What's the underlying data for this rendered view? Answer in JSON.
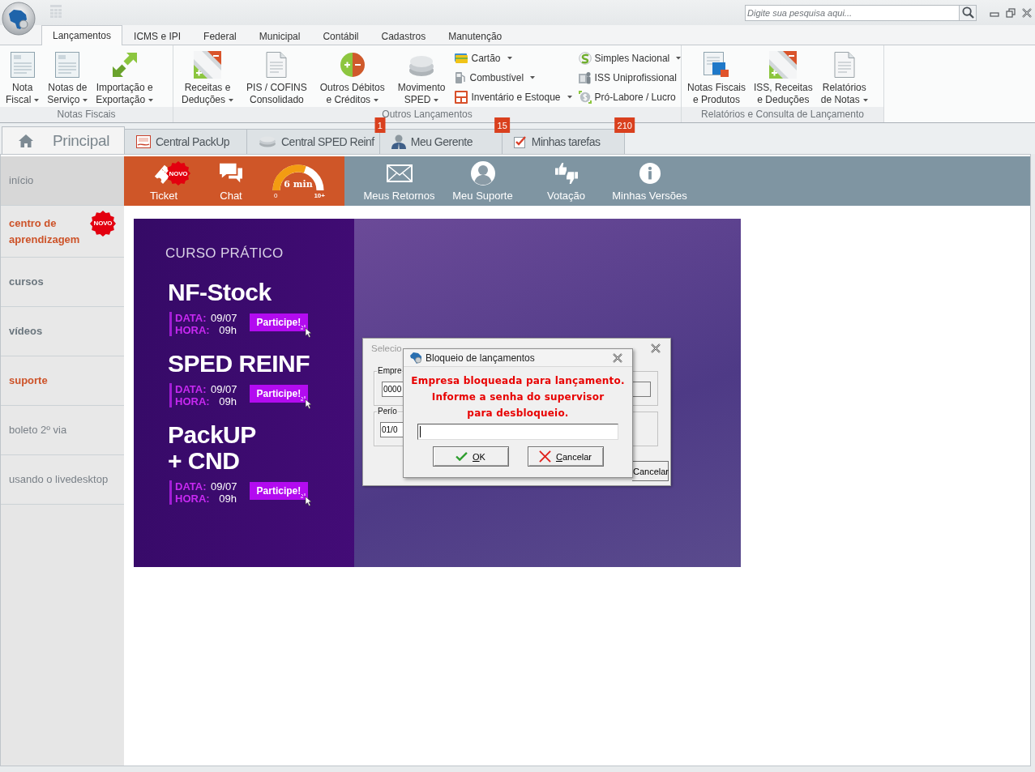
{
  "title_bar": {
    "search": {
      "placeholder": "Digite sua pesquisa aqui..."
    }
  },
  "ribbon": {
    "tabs": [
      {
        "label": "Lançamentos",
        "selected": true
      },
      {
        "label": "ICMS e IPI",
        "selected": false
      },
      {
        "label": "Federal",
        "selected": false
      },
      {
        "label": "Municipal",
        "selected": false
      },
      {
        "label": "Contábil",
        "selected": false
      },
      {
        "label": "Cadastros",
        "selected": false
      },
      {
        "label": "Manutenção",
        "selected": false
      }
    ],
    "groups": [
      {
        "label": "Notas Fiscais",
        "large": [
          {
            "label": "Nota\nFiscal",
            "dropdown": true
          },
          {
            "label": "Notas de\nServiço",
            "dropdown": true
          },
          {
            "label": "Importação e\nExportação",
            "dropdown": true
          }
        ]
      },
      {
        "label": "Outros Lançamentos",
        "large": [
          {
            "label": "Receitas e\nDeduções",
            "dropdown": true
          },
          {
            "label": "PIS / COFINS\nConsolidado",
            "dropdown": false
          },
          {
            "label": "Outros Débitos\ne Créditos",
            "dropdown": true
          },
          {
            "label": "Movimento\nSPED",
            "dropdown": true
          }
        ],
        "small_columns": [
          [
            {
              "label": "Cartão",
              "dropdown": true
            },
            {
              "label": "Combustível",
              "dropdown": true
            },
            {
              "label": "Inventário e Estoque",
              "dropdown": true
            }
          ],
          [
            {
              "label": "Simples Nacional",
              "dropdown": true
            },
            {
              "label": "ISS Uniprofissional",
              "dropdown": false
            },
            {
              "label": "Pró-Labore / Lucro",
              "dropdown": false
            }
          ]
        ]
      },
      {
        "label": "Relatórios e Consulta de Lançamento",
        "large": [
          {
            "label": "Notas Fiscais\ne Produtos",
            "dropdown": false
          },
          {
            "label": "ISS, Receitas\ne Deduções",
            "dropdown": false
          },
          {
            "label": "Relatórios\nde Notas",
            "dropdown": true
          }
        ]
      }
    ]
  },
  "document_tabs": [
    {
      "label": "Principal",
      "selected": true
    },
    {
      "label": "Central PackUp",
      "selected": false
    },
    {
      "label": "Central SPED Reinf",
      "selected": false,
      "badge": "1"
    },
    {
      "label": "Meu Gerente",
      "selected": false,
      "badge": "15"
    },
    {
      "label": "Minhas tarefas",
      "selected": false,
      "badge": "210"
    }
  ],
  "sidebar": {
    "items": [
      {
        "label": "início",
        "kind": "plain",
        "selected": true
      },
      {
        "label": "centro de aprendizagem",
        "kind": "featured",
        "selected": false,
        "badge": "NOVO"
      },
      {
        "label": "cursos",
        "kind": "category",
        "selected": false
      },
      {
        "label": "vídeos",
        "kind": "category",
        "selected": false
      },
      {
        "label": "suporte",
        "kind": "featured",
        "selected": false
      },
      {
        "label": "boleto 2º via",
        "kind": "plain",
        "selected": false
      },
      {
        "label": "usando o livedesktop",
        "kind": "plain",
        "selected": false
      }
    ]
  },
  "toolbar": {
    "left": [
      {
        "kind": "ticket",
        "label": "Ticket",
        "badge": "NOVO"
      },
      {
        "kind": "chat",
        "label": "Chat"
      },
      {
        "kind": "gauge",
        "reading": "6 min",
        "min_label": "0",
        "max_label": "10+",
        "level": 0.6
      }
    ],
    "right": [
      {
        "label": "Meus Retornos"
      },
      {
        "label": "Meu Suporte"
      },
      {
        "label": "Votação"
      },
      {
        "label": "Minhas Versões"
      }
    ]
  },
  "banner": {
    "kicker": "CURSO PRÁTICO",
    "courses": [
      {
        "title": "NF-Stock",
        "date_label": "DATA:",
        "date": "09/07",
        "time_label": "HORA:",
        "time": "09h",
        "button": "Participe!"
      },
      {
        "title": "SPED REINF",
        "date_label": "DATA:",
        "date": "09/07",
        "time_label": "HORA:",
        "time": "09h",
        "button": "Participe!"
      },
      {
        "title": "PackUP\n+ CND",
        "date_label": "DATA:",
        "date": "09/07",
        "time_label": "HORA:",
        "time": "09h",
        "button": "Participe!"
      }
    ]
  },
  "back_dialog": {
    "title": "Selecio",
    "groups": [
      {
        "label": "Empre",
        "value": "0000"
      },
      {
        "label": "Perío",
        "value": "01/0"
      }
    ],
    "button": "Cancelar"
  },
  "lock_dialog": {
    "title": "Bloqueio de lançamentos",
    "message": "Empresa bloqueada para lançamento.\nInforme a senha do supervisor\npara desbloqueio.",
    "password": {
      "focused": true
    },
    "buttons": [
      {
        "kind": "ok",
        "label": "OK"
      },
      {
        "kind": "cancel",
        "label": "Cancelar"
      }
    ]
  }
}
